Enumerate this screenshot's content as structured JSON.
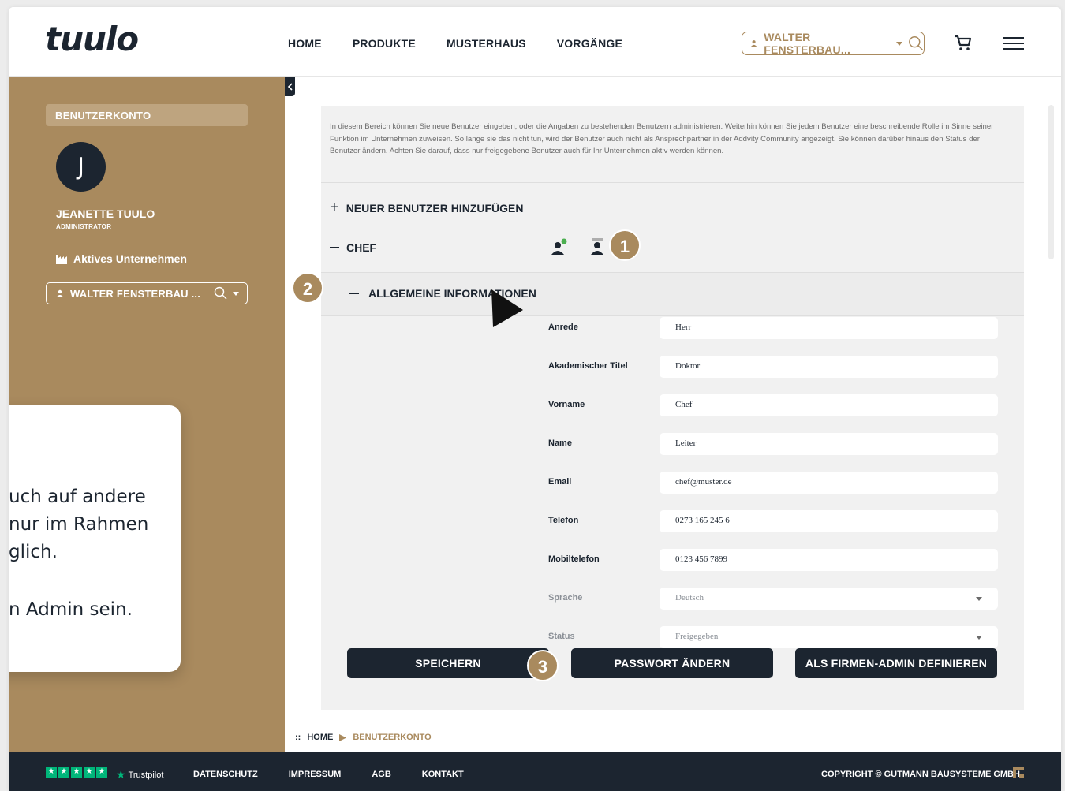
{
  "header": {
    "logo": "tuulo",
    "nav": [
      "HOME",
      "PRODUKTE",
      "MUSTERHAUS",
      "VORGÄNGE"
    ],
    "company_select": "WALTER FENSTERBAU..."
  },
  "sidebar": {
    "account_label": "BENUTZERKONTO",
    "avatar_initial": "J",
    "user_name": "JEANETTE TUULO",
    "user_role": "ADMINISTRATOR",
    "active_company_label": "Aktives Unternehmen",
    "company_select": "WALTER FENSTERBAU ..."
  },
  "tooltip": {
    "lines": [
      "uch auf andere",
      "nur im Rahmen",
      "glich.",
      "n Admin sein."
    ]
  },
  "main": {
    "intro": "In diesem Bereich können Sie neue Benutzer eingeben, oder die Angaben zu bestehenden Benutzern administrieren. Weiterhin können Sie jedem Benutzer eine beschreibende Rolle im Sinne seiner Funktion im Unternehmen zuweisen. So lange sie das nicht tun, wird der Benutzer auch nicht als Ansprechpartner in der Addvity Community angezeigt. Sie können darüber hinaus den Status der Benutzer ändern. Achten Sie darauf, dass nur freigegebene Benutzer auch für Ihr Unternehmen aktiv werden können.",
    "add_user": "NEUER BENUTZER HINZUFÜGEN",
    "chef_label": "CHEF",
    "section_label": "ALLGEMEINE INFORMATIONEN",
    "form": [
      {
        "label": "Anrede",
        "value": "Herr"
      },
      {
        "label": "Akademischer Titel",
        "value": "Doktor"
      },
      {
        "label": "Vorname",
        "value": "Chef"
      },
      {
        "label": "Name",
        "value": "Leiter"
      },
      {
        "label": "Email",
        "value": "chef@muster.de"
      },
      {
        "label": "Telefon",
        "value": "0273 165 245 6"
      },
      {
        "label": "Mobiltelefon",
        "value": "0123 456 7899"
      },
      {
        "label": "Sprache",
        "value": "Deutsch"
      },
      {
        "label": "Status",
        "value": "Freigegeben"
      }
    ],
    "buttons": {
      "save": "SPEICHERN",
      "password": "PASSWORT ÄNDERN",
      "admin": "ALS FIRMEN-ADMIN DEFINIEREN"
    }
  },
  "badges": [
    "1",
    "2",
    "3"
  ],
  "breadcrumb": {
    "home": "HOME",
    "current": "BENUTZERKONTO"
  },
  "footer": {
    "trustpilot": "Trustpilot",
    "links": [
      "DATENSCHUTZ",
      "IMPRESSUM",
      "AGB",
      "KONTAKT"
    ],
    "copyright": "COPYRIGHT © GUTMANN BAUSYSTEME GMBH"
  },
  "colors": {
    "brand_gold": "#a98a5e",
    "dark_navy": "#1c2530",
    "trustpilot_green": "#00b67a"
  }
}
